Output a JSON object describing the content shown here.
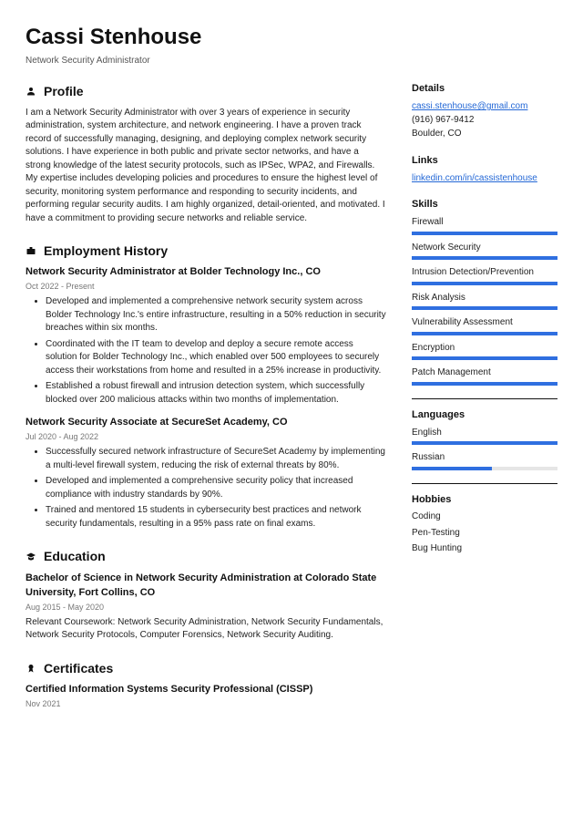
{
  "header": {
    "name": "Cassi Stenhouse",
    "role": "Network Security Administrator"
  },
  "sections": {
    "profile_title": "Profile",
    "profile_text": "I am a Network Security Administrator with over 3 years of experience in security administration, system architecture, and network engineering. I have a proven track record of successfully managing, designing, and deploying complex network security solutions. I have experience in both public and private sector networks, and have a strong knowledge of the latest security protocols, such as IPSec, WPA2, and Firewalls. My expertise includes developing policies and procedures to ensure the highest level of security, monitoring system performance and responding to security incidents, and performing regular security audits. I am highly organized, detail-oriented, and motivated. I have a commitment to providing secure networks and reliable service.",
    "employment_title": "Employment History",
    "education_title": "Education",
    "certificates_title": "Certificates"
  },
  "jobs": [
    {
      "title": "Network Security Administrator at Bolder Technology Inc., CO",
      "dates": "Oct 2022 - Present",
      "bullets": [
        "Developed and implemented a comprehensive network security system across Bolder Technology Inc.'s entire infrastructure, resulting in a 50% reduction in security breaches within six months.",
        "Coordinated with the IT team to develop and deploy a secure remote access solution for Bolder Technology Inc., which enabled over 500 employees to securely access their workstations from home and resulted in a 25% increase in productivity.",
        "Established a robust firewall and intrusion detection system, which successfully blocked over 200 malicious attacks within two months of implementation."
      ]
    },
    {
      "title": "Network Security Associate at SecureSet Academy, CO",
      "dates": "Jul 2020 - Aug 2022",
      "bullets": [
        "Successfully secured network infrastructure of SecureSet Academy by implementing a multi-level firewall system, reducing the risk of external threats by 80%.",
        "Developed and implemented a comprehensive security policy that increased compliance with industry standards by 90%.",
        "Trained and mentored 15 students in cybersecurity best practices and network security fundamentals, resulting in a 95% pass rate on final exams."
      ]
    }
  ],
  "education": {
    "title": "Bachelor of Science in Network Security Administration at Colorado State University, Fort Collins, CO",
    "dates": "Aug 2015 - May 2020",
    "text": "Relevant Coursework: Network Security Administration, Network Security Fundamentals, Network Security Protocols, Computer Forensics, Network Security Auditing."
  },
  "certificates": [
    {
      "title": "Certified Information Systems Security Professional (CISSP)",
      "dates": "Nov 2021"
    }
  ],
  "details": {
    "title": "Details",
    "email": "cassi.stenhouse@gmail.com",
    "phone": "(916) 967-9412",
    "location": "Boulder, CO"
  },
  "links": {
    "title": "Links",
    "items": [
      "linkedin.com/in/cassistenhouse"
    ]
  },
  "skills": {
    "title": "Skills",
    "items": [
      {
        "label": "Firewall",
        "level": 100
      },
      {
        "label": "Network Security",
        "level": 100
      },
      {
        "label": "Intrusion Detection/Prevention",
        "level": 100
      },
      {
        "label": "Risk Analysis",
        "level": 100
      },
      {
        "label": "Vulnerability Assessment",
        "level": 100
      },
      {
        "label": "Encryption",
        "level": 100
      },
      {
        "label": "Patch Management",
        "level": 100
      }
    ]
  },
  "languages": {
    "title": "Languages",
    "items": [
      {
        "label": "English",
        "level": 100
      },
      {
        "label": "Russian",
        "level": 55
      }
    ]
  },
  "hobbies": {
    "title": "Hobbies",
    "items": [
      "Coding",
      "Pen-Testing",
      "Bug Hunting"
    ]
  }
}
